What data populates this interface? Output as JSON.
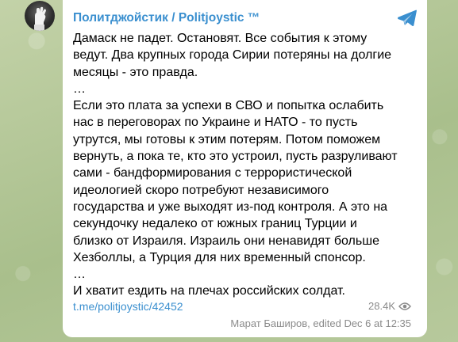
{
  "channel": {
    "name": "Политджойстик / Politjoystic ™",
    "avatar_icon": "fist-avatar-icon"
  },
  "message": {
    "text": "Дамаск не падет. Остановят. Все события к этому\nведут. Два крупных города Сирии потеряны на долгие\nмесяцы - это правда.\n…\nЕсли это плата за успехи в СВО и попытка ослабить\nнас в переговорах по Украине и НАТО - то пусть\nутрутся, мы готовы к этим потерям. Потом поможем\nвернуть, а пока те, кто это устроил, пусть разруливают\nсами - бандформирования с террористической\nидеологией скоро потребуют независимого\nгосударства и уже выходят из-под контроля. А это на\nсекундочку недалеко от южных границ Турции и\nблизко от Израиля. Израиль они ненавидят больше\nХезболлы, а Турция для них временный спонсор.\n…\nИ хватит ездить на плечах российских солдат.",
    "link": "t.me/politjoystic/42452",
    "views": "28.4K",
    "signature": "Марат Баширов, edited  Dec 6 at 12:35"
  },
  "icons": {
    "share": "telegram-share-icon",
    "views": "eye-icon"
  },
  "colors": {
    "accent": "#3a8fcf",
    "muted": "#8a8a8a",
    "bubble": "#ffffff",
    "background": "#b4c69a"
  }
}
